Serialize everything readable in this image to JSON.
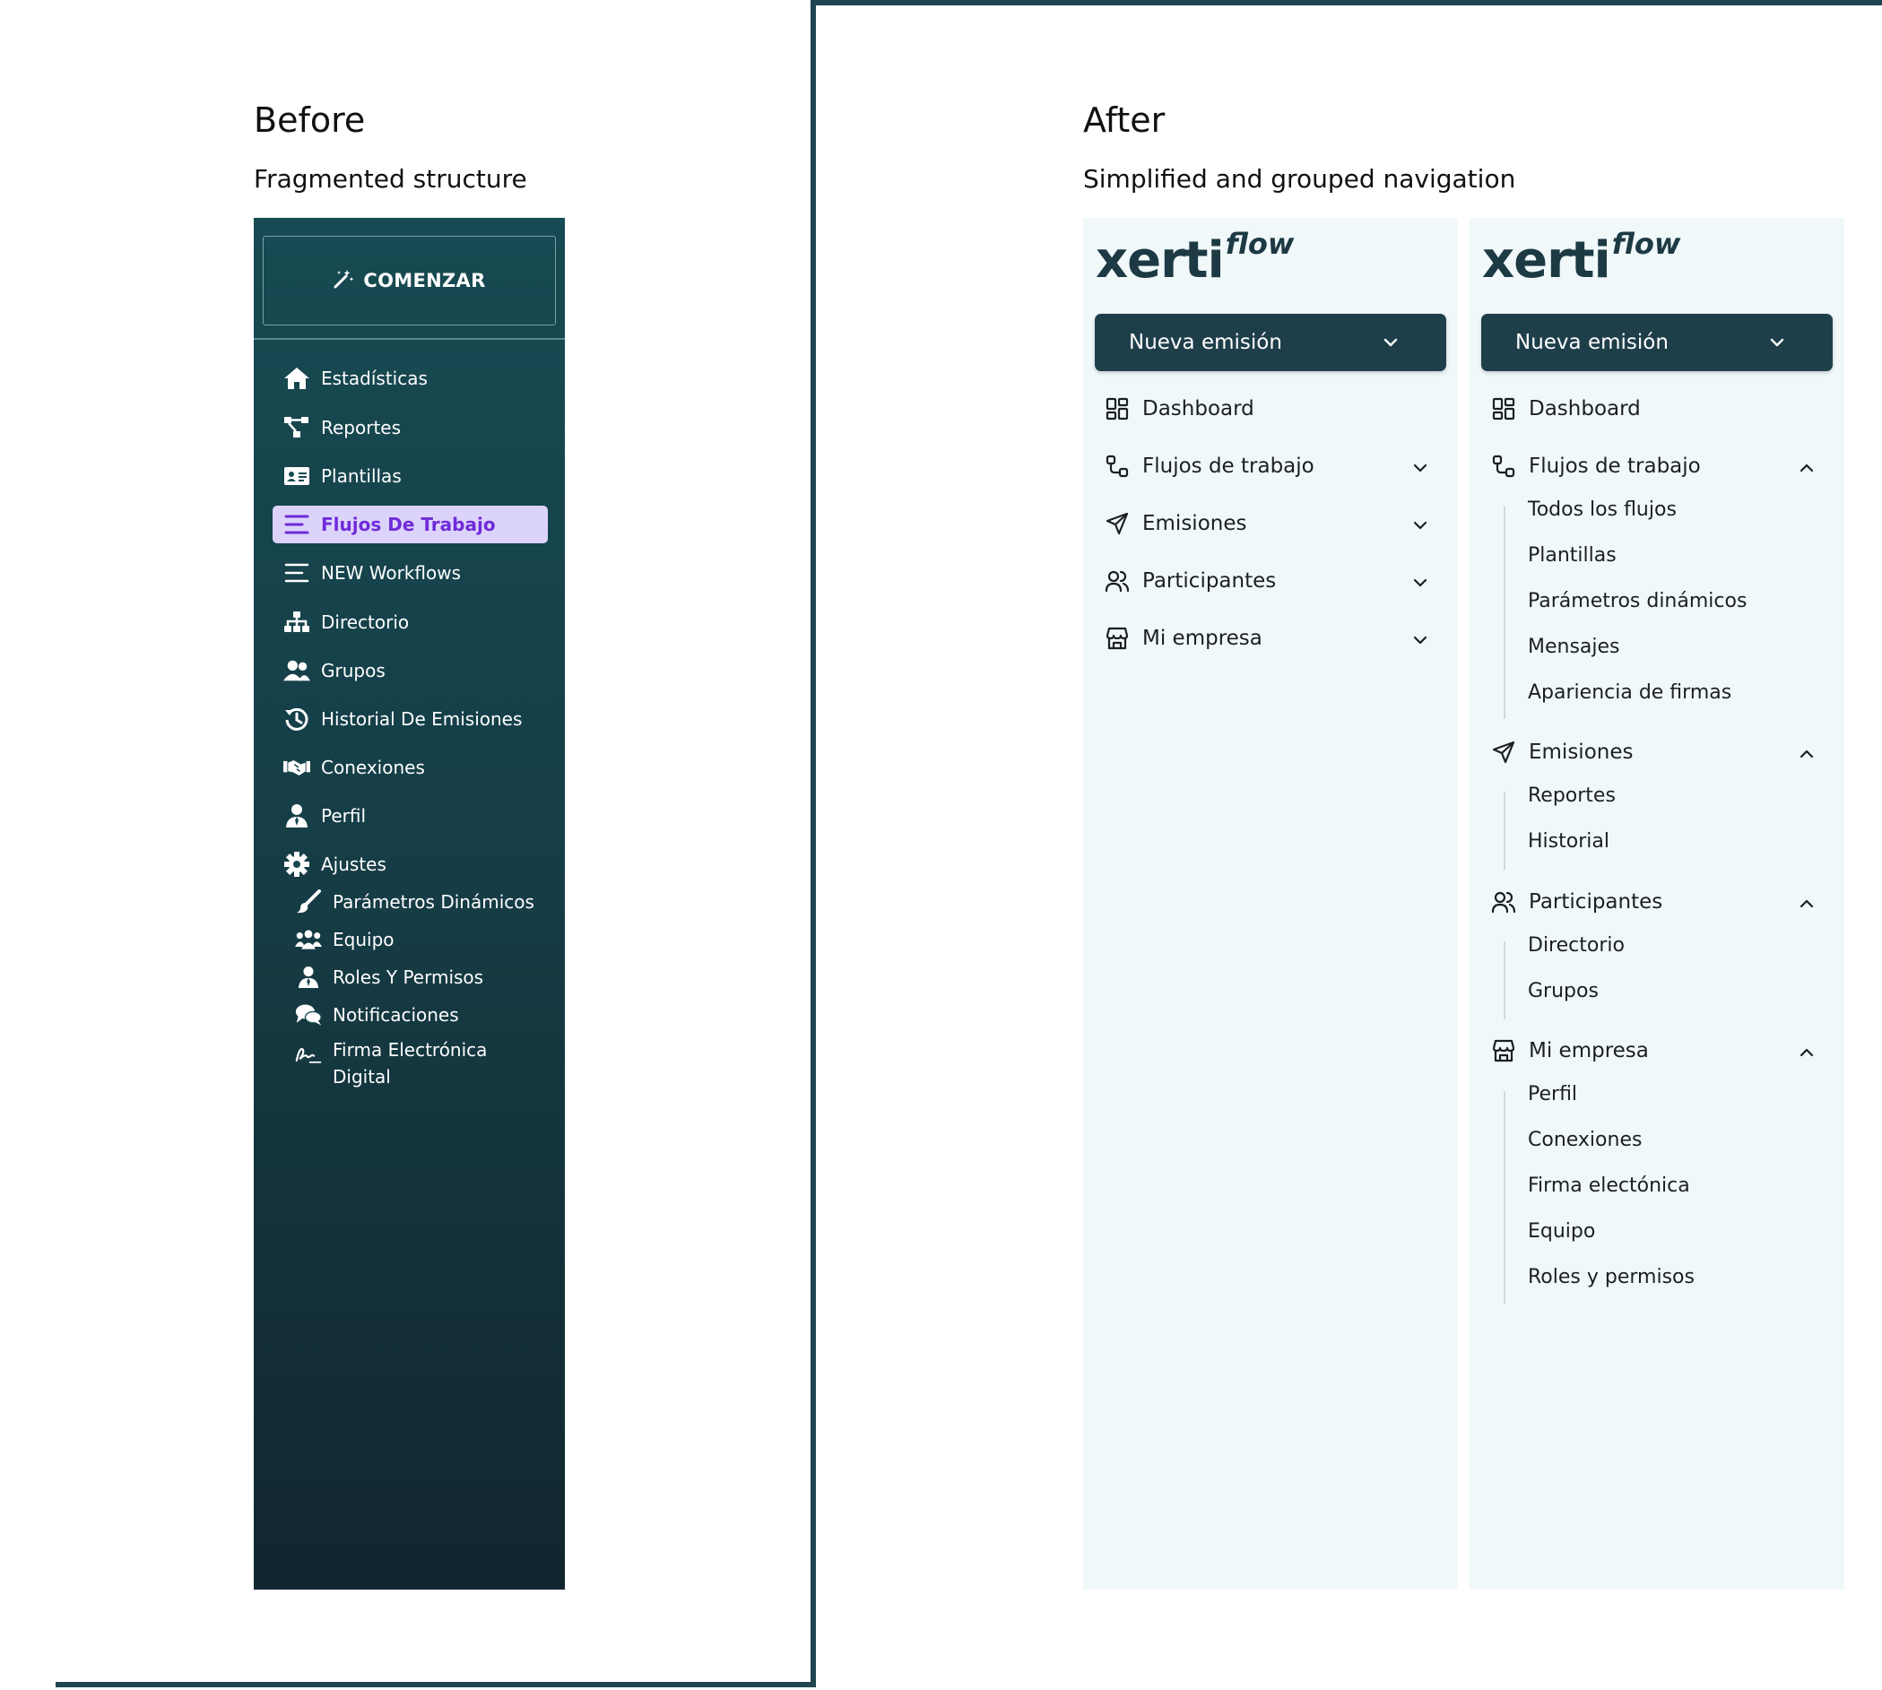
{
  "before": {
    "title": "Before",
    "subtitle": "Fragmented structure",
    "start_button": "COMENZAR",
    "items": [
      {
        "label": "Estadísticas",
        "icon": "home-icon"
      },
      {
        "label": "Reportes",
        "icon": "share-nodes-icon"
      },
      {
        "label": "Plantillas",
        "icon": "id-card-icon"
      },
      {
        "label": "Flujos De Trabajo",
        "icon": "list-icon",
        "active": true
      },
      {
        "label": "NEW Workflows",
        "icon": "list-icon"
      },
      {
        "label": "Directorio",
        "icon": "sitemap-icon"
      },
      {
        "label": "Grupos",
        "icon": "users-icon"
      },
      {
        "label": "Historial De Emisiones",
        "icon": "history-icon"
      },
      {
        "label": "Conexiones",
        "icon": "handshake-icon"
      },
      {
        "label": "Perfil",
        "icon": "user-tie-icon"
      },
      {
        "label": "Ajustes",
        "icon": "gear-icon"
      }
    ],
    "sub_items": [
      {
        "label": "Parámetros Dinámicos",
        "icon": "brush-icon"
      },
      {
        "label": "Equipo",
        "icon": "team-icon"
      },
      {
        "label": "Roles Y Permisos",
        "icon": "user-tie-icon"
      },
      {
        "label": "Notificaciones",
        "icon": "comments-icon"
      },
      {
        "label": "Firma Electrónica Digital",
        "icon": "signature-icon"
      }
    ],
    "colors": {
      "bg_top": "#174a52",
      "bg_bottom": "#11262e",
      "active_bg": "#dcd3fb",
      "active_text": "#6f2bd9"
    }
  },
  "after": {
    "title": "After",
    "subtitle": "Simplified and grouped navigation",
    "logo_main": "xerti",
    "logo_sup": "flow",
    "new_button": "Nueva emisión",
    "collapsed": {
      "items": [
        {
          "label": "Dashboard",
          "icon": "grid-icon"
        },
        {
          "label": "Flujos de trabajo",
          "icon": "workflow-icon"
        },
        {
          "label": "Emisiones",
          "icon": "send-icon"
        },
        {
          "label": "Participantes",
          "icon": "users-icon"
        },
        {
          "label": "Mi empresa",
          "icon": "store-icon"
        }
      ]
    },
    "expanded": {
      "dashboard": "Dashboard",
      "flujos": {
        "label": "Flujos de trabajo",
        "children": [
          "Todos los flujos",
          "Plantillas",
          "Parámetros dinámicos",
          "Mensajes",
          "Apariencia de firmas"
        ]
      },
      "emisiones": {
        "label": "Emisiones",
        "children": [
          "Reportes",
          "Historial"
        ]
      },
      "participantes": {
        "label": "Participantes",
        "children": [
          "Directorio",
          "Grupos"
        ]
      },
      "empresa": {
        "label": "Mi empresa",
        "children": [
          "Perfil",
          "Conexiones",
          "Firma electónica",
          "Equipo",
          "Roles y permisos"
        ]
      }
    },
    "colors": {
      "panel_bg": "#f0f8fa",
      "button_bg": "#1e3e4a",
      "logo": "#1d3a44"
    }
  }
}
